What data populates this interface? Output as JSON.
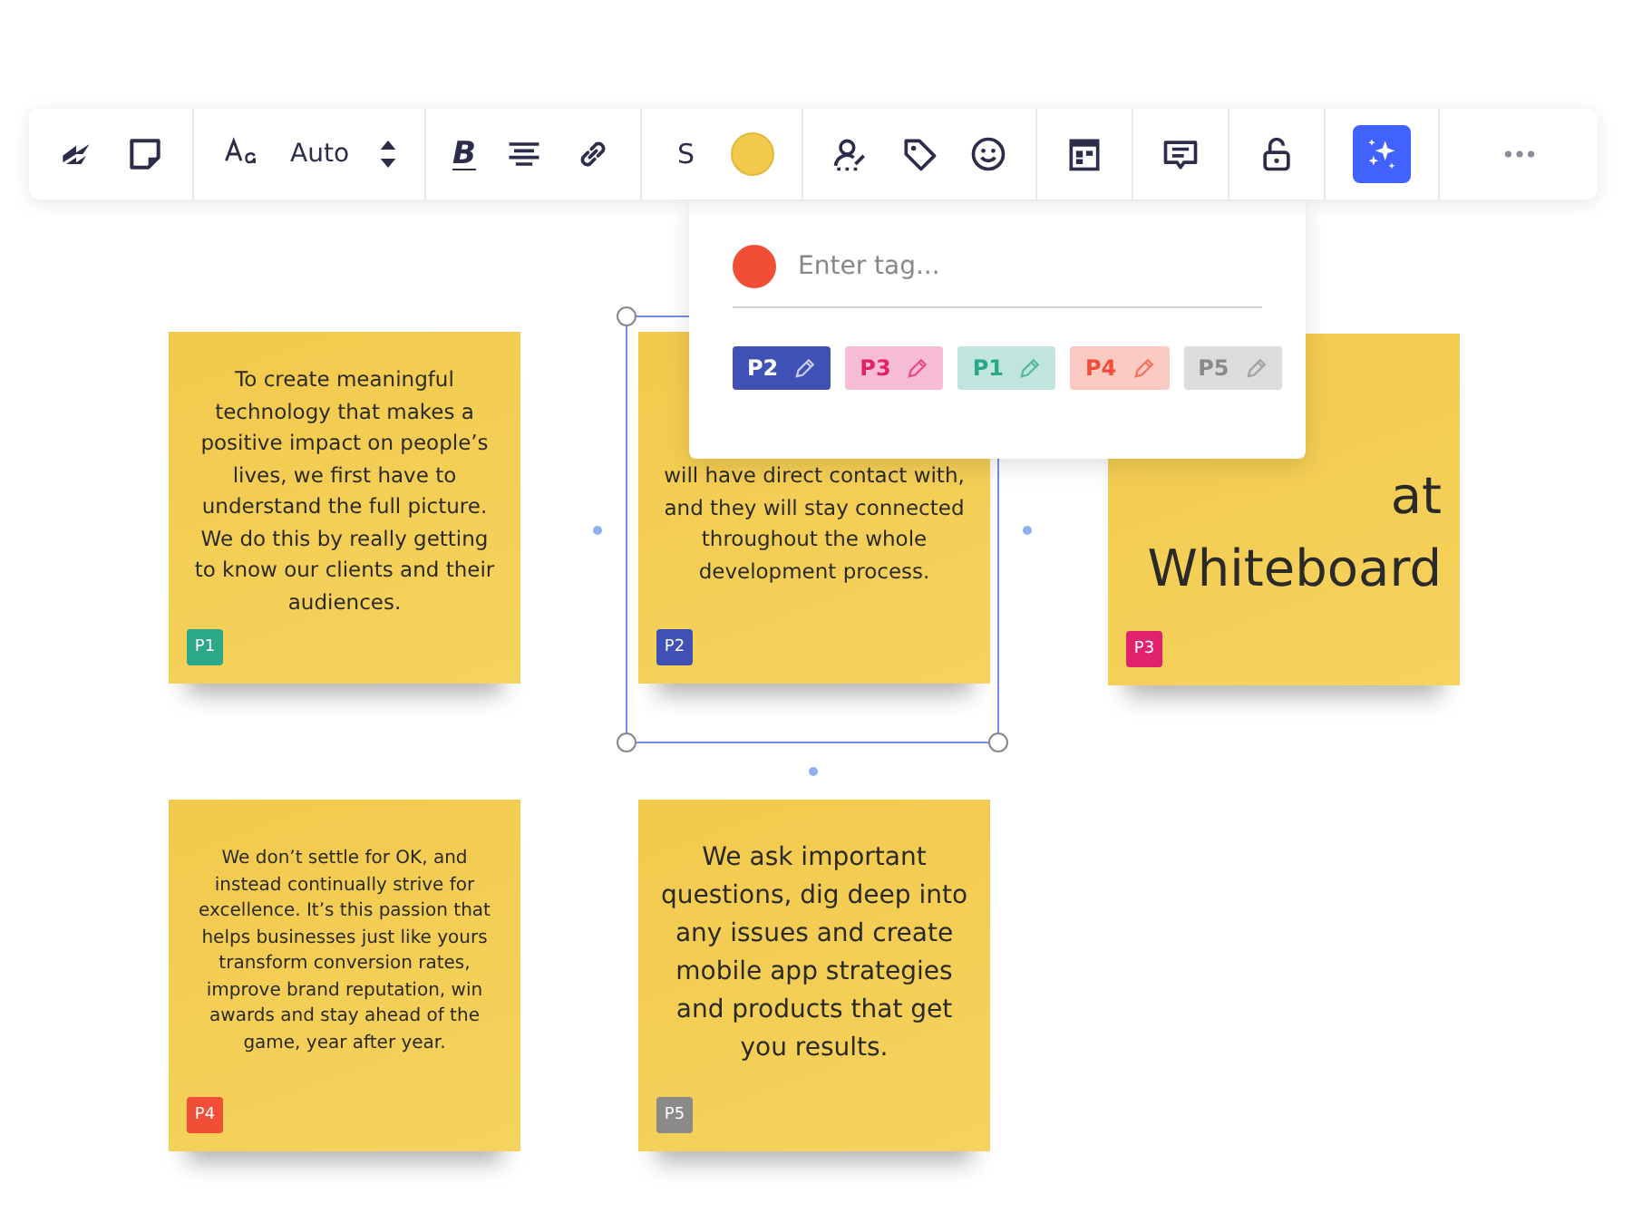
{
  "toolbar": {
    "font_size": "Auto",
    "bold_label": "B",
    "size_label": "S",
    "color": "#f2c94c"
  },
  "tag_popup": {
    "color": "#f04e37",
    "placeholder": "Enter tag...",
    "tags": [
      {
        "label": "P2",
        "color": "#3f51b5",
        "selected": true
      },
      {
        "label": "P3",
        "color": "#e0216b",
        "selected": false
      },
      {
        "label": "P1",
        "color": "#2aa889",
        "selected": false
      },
      {
        "label": "P4",
        "color": "#f04e37",
        "selected": false
      },
      {
        "label": "P5",
        "color": "#8a8a8a",
        "selected": false
      }
    ]
  },
  "notes": [
    {
      "kind": "medium",
      "text": "To create meaningful technology that makes a positive impact on people’s lives, we first have to understand the full picture. We do this by really getting to know our clients and their audiences.",
      "tag": "P1",
      "color": "#2aa889",
      "selected": false
    },
    {
      "kind": "medium",
      "text": "will have direct contact with, and they will stay connected throughout the whole development process.",
      "tag": "P2",
      "color": "#3f51b5",
      "selected": true
    },
    {
      "kind": "huge",
      "text": "at Whiteboard",
      "tag": "P3",
      "color": "#e0216b",
      "selected": false
    },
    {
      "kind": "small",
      "text": "We don’t settle for OK, and instead continually strive for excellence. It’s this passion that helps businesses just like yours transform conversion rates, improve brand reputation, win awards and stay ahead of the game, year after year.",
      "tag": "P4",
      "color": "#f04e37",
      "selected": false
    },
    {
      "kind": "large",
      "text": "We ask important questions, dig deep into any issues and create mobile app strategies and products that get you results.",
      "tag": "P5",
      "color": "#8a8a8a",
      "selected": false
    }
  ]
}
